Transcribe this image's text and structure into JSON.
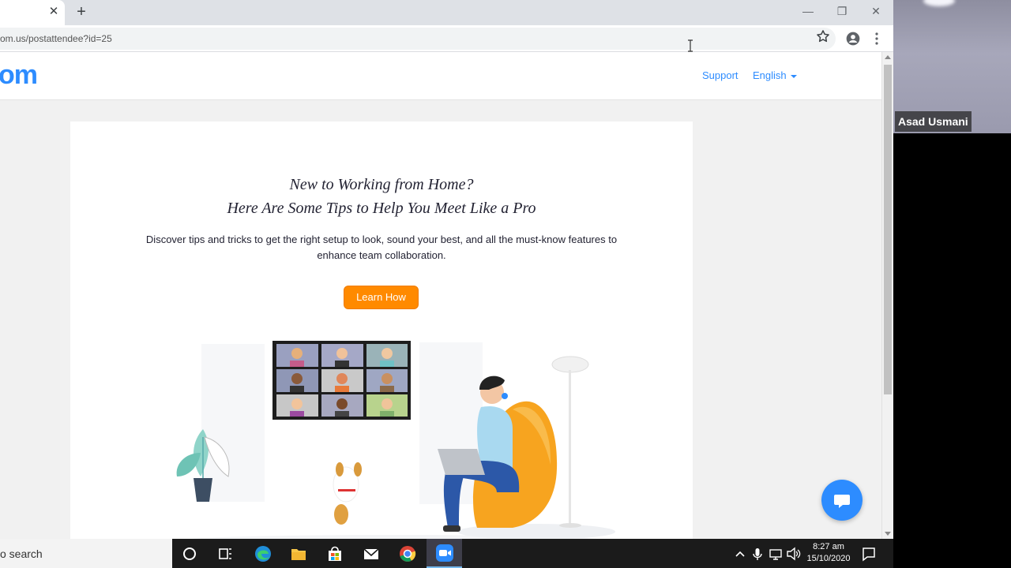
{
  "browser": {
    "url": "om.us/postattendee?id=25"
  },
  "site": {
    "logo_text": "om",
    "support_label": "Support",
    "language_label": "English",
    "brand_color": "#2d8cff"
  },
  "promo": {
    "heading_line1": "New to Working from Home?",
    "heading_line2": "Here Are Some Tips to Help You Meet Like a Pro",
    "description_line1": "Discover tips and tricks to get the right setup to look, sound your best, and all the must-know features to",
    "description_line2": "enhance team collaboration.",
    "button_label": "Learn How",
    "button_color": "#ff8a00"
  },
  "video": {
    "participant_name": "Asad Usmani"
  },
  "taskbar": {
    "search_text": "o search",
    "clock_time": "8:27 am",
    "clock_date": "15/10/2020",
    "icons": [
      "cortana-icon",
      "task-view-icon",
      "edge-icon",
      "file-explorer-icon",
      "store-icon",
      "mail-icon",
      "chrome-icon",
      "zoom-icon"
    ]
  }
}
